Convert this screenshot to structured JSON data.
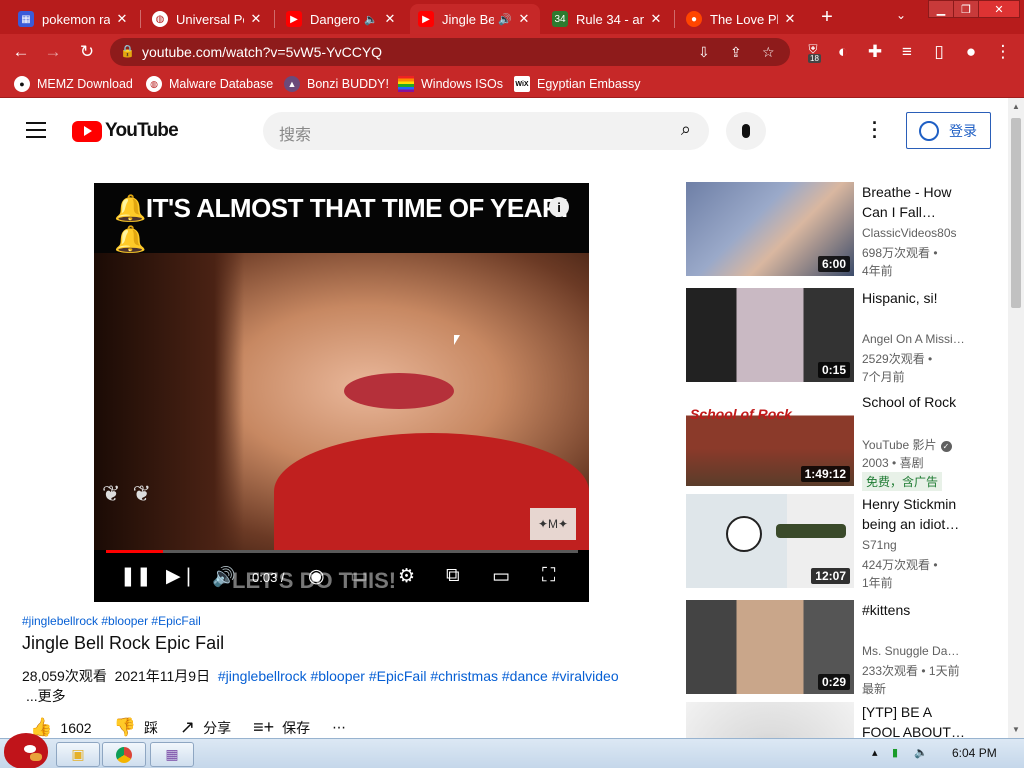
{
  "browser": {
    "tabs": [
      {
        "title": "pokemon ran",
        "favicon": "pokemon-favicon",
        "color": "#3a5bd9"
      },
      {
        "title": "Universal Pol",
        "favicon": "globe-favicon",
        "color": "#ffffff"
      },
      {
        "title": "Dangero",
        "favicon": "youtube-favicon",
        "color": "#ff0000",
        "audio": "🔈"
      },
      {
        "title": "Jingle Be",
        "favicon": "youtube-favicon",
        "color": "#ff0000",
        "audio": "🔊",
        "active": true
      },
      {
        "title": "Rule 34 - an",
        "favicon": "rule34-favicon",
        "color": "#2f7a2f"
      },
      {
        "title": "The Love Plu",
        "favicon": "reddit-favicon",
        "color": "#ff4500"
      }
    ],
    "new_tab": "+",
    "url": "youtube.com/watch?v=5vW5-YvCCYQ",
    "extension_badge": "18",
    "bookmarks": [
      {
        "label": "MEMZ Download",
        "icon": "github-icon"
      },
      {
        "label": "Malware Database",
        "icon": "globe-icon"
      },
      {
        "label": "Bonzi BUDDY!",
        "icon": "bonzi-icon"
      },
      {
        "label": "Windows ISOs",
        "icon": "rainbow-flag-icon"
      },
      {
        "label": "Egyptian Embassy",
        "icon": "wix-icon"
      }
    ],
    "colors": {
      "frame": "#b71c1c",
      "toolbar": "#c62828"
    }
  },
  "youtube": {
    "logo_text": "YouTube",
    "search_placeholder": "搜索",
    "sign_in": "登录",
    "video": {
      "banner_text": "IT'S ALMOST THAT TIME OF YEAR!",
      "time": "0:03 /",
      "subtitle": "LET'S DO THIS!",
      "progress_fraction": 0.12,
      "hashtags_top": "#jinglebellrock #blooper #EpicFail",
      "title": "Jingle Bell Rock Epic Fail",
      "views": "28,059次观看",
      "date": "2021年11月9日",
      "hashtags": "#jinglebellrock #blooper #EpicFail #christmas #dance #viralvideo",
      "more": "...更多",
      "likes": "1602",
      "dislike": "踩",
      "share": "分享",
      "save": "保存"
    },
    "recommendations": [
      {
        "title": "Breathe - How Can I Fall…",
        "channel": "ClassicVideos80s",
        "views": "698万次观看 •",
        "age": "4年前",
        "duration": "6:00"
      },
      {
        "title": "Hispanic, si!",
        "channel": "Angel On A Missi…",
        "views": "2529次观看 •",
        "age": "7个月前",
        "duration": "0:15"
      },
      {
        "title": "School of Rock",
        "channel": "YouTube 影片",
        "views": "2003 • 喜剧",
        "badge": "免费，含广告",
        "duration": "1:49:12",
        "verified": true
      },
      {
        "title": "Henry Stickmin being an idiot…",
        "channel": "S71ng",
        "views": "424万次观看 •",
        "age": "1年前",
        "duration": "12:07"
      },
      {
        "title": "#kittens",
        "channel": "Ms. Snuggle Da…",
        "views": "233次观看 • 1天前",
        "age": "最新",
        "duration": "0:29"
      },
      {
        "title": "[YTP] BE A FOOL ABOUT…",
        "channel": "",
        "views": "",
        "age": "",
        "duration": ""
      }
    ]
  },
  "taskbar": {
    "clock": "6:04 PM"
  }
}
